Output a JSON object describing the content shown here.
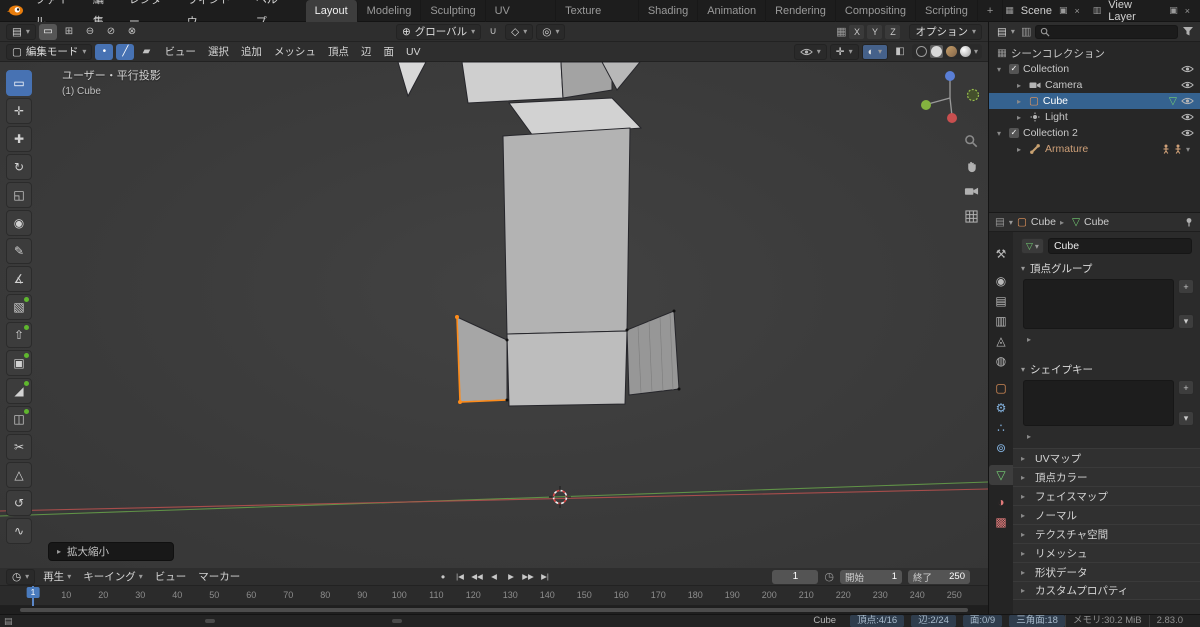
{
  "icons": {
    "chevron-down": "▾",
    "chevron-right": "▸",
    "editor-grid": "▤",
    "clock": "◷",
    "mode-new": "▭",
    "mode-extend": "⊞",
    "mode-subtract": "⊖",
    "mode-invert": "⊘",
    "mode-intersect": "⊗",
    "orientation-globe": "⊕",
    "magnet": "∪",
    "snap-target": "◇",
    "proportional": "◎",
    "falloff-grid": "▦",
    "mode-cube": "▢",
    "vertex-mode": "•",
    "edge-mode": "╱",
    "face-mode": "▰",
    "gizmo": "✛",
    "overlays": "◐",
    "xray": "◧",
    "scene": "▦",
    "view-layer": "▥",
    "copy": "▣",
    "close": "×",
    "collection": "▦",
    "mesh-data": "▽",
    "cube-object": "▢",
    "check": "✓",
    "plus": "+",
    "minus": "−"
  },
  "topbar": {
    "menus": [
      {
        "name": "menu-file",
        "label": "ファイル"
      },
      {
        "name": "menu-edit",
        "label": "編集"
      },
      {
        "name": "menu-render",
        "label": "レンダー"
      },
      {
        "name": "menu-window",
        "label": "ウィンドウ"
      },
      {
        "name": "menu-help",
        "label": "ヘルプ"
      }
    ],
    "workspaces": [
      {
        "name": "workspace-tab-layout",
        "label": "Layout",
        "active": true
      },
      {
        "name": "workspace-tab-modeling",
        "label": "Modeling"
      },
      {
        "name": "workspace-tab-sculpting",
        "label": "Sculpting"
      },
      {
        "name": "workspace-tab-uv-editing",
        "label": "UV Editing"
      },
      {
        "name": "workspace-tab-texture-paint",
        "label": "Texture Paint"
      },
      {
        "name": "workspace-tab-shading",
        "label": "Shading"
      },
      {
        "name": "workspace-tab-animation",
        "label": "Animation"
      },
      {
        "name": "workspace-tab-rendering",
        "label": "Rendering"
      },
      {
        "name": "workspace-tab-compositing",
        "label": "Compositing"
      },
      {
        "name": "workspace-tab-scripting",
        "label": "Scripting"
      },
      {
        "name": "add-workspace-button",
        "label": "+"
      }
    ],
    "scene_label": "Scene",
    "view_layer_label": "View Layer"
  },
  "tool_settings": {
    "orientation_label": "グローバル",
    "axis_x": "X",
    "axis_y": "Y",
    "axis_z": "Z",
    "options_label": "オプション"
  },
  "header3d": {
    "mode_label": "編集モード",
    "menus": [
      {
        "name": "menu-view",
        "label": "ビュー"
      },
      {
        "name": "menu-select",
        "label": "選択"
      },
      {
        "name": "menu-add",
        "label": "追加"
      },
      {
        "name": "menu-mesh",
        "label": "メッシュ"
      },
      {
        "name": "menu-vertex",
        "label": "頂点"
      },
      {
        "name": "menu-edge",
        "label": "辺"
      },
      {
        "name": "menu-face",
        "label": "面"
      },
      {
        "name": "menu-uv",
        "label": "UV"
      }
    ]
  },
  "toolbar": {
    "tools": [
      {
        "name": "tool-select-box",
        "glyph": "▭",
        "active": true
      },
      {
        "name": "tool-cursor",
        "glyph": "✛"
      },
      {
        "name": "tool-move",
        "glyph": "✚"
      },
      {
        "name": "tool-rotate",
        "glyph": "↻"
      },
      {
        "name": "tool-scale",
        "glyph": "◱"
      },
      {
        "name": "tool-transform",
        "glyph": "◉"
      },
      {
        "name": "tool-annotate",
        "glyph": "✎"
      },
      {
        "name": "tool-measure",
        "glyph": "∡"
      },
      {
        "name": "tool-add-cube",
        "glyph": "▧",
        "badge": true
      },
      {
        "name": "tool-extrude",
        "glyph": "⇧",
        "badge": true
      },
      {
        "name": "tool-inset",
        "glyph": "▣",
        "badge": true
      },
      {
        "name": "tool-bevel",
        "glyph": "◢",
        "badge": true
      },
      {
        "name": "tool-loop-cut",
        "glyph": "◫",
        "badge": true
      },
      {
        "name": "tool-knife",
        "glyph": "✂"
      },
      {
        "name": "tool-poly-build",
        "glyph": "△"
      },
      {
        "name": "tool-spin",
        "glyph": "↺"
      },
      {
        "name": "tool-smooth",
        "glyph": "∿"
      }
    ]
  },
  "viewport": {
    "view_label": "ユーザー・平行投影",
    "object_label": "(1) Cube",
    "operator_panel_label": "拡大縮小",
    "axis_x_color": "#b4504e",
    "axis_y_color": "#67a24a",
    "selection_color": "#ff8c1a"
  },
  "timeline": {
    "editor_menus": [
      {
        "name": "menu-playback",
        "label": "再生",
        "caret": true
      },
      {
        "name": "menu-keying",
        "label": "キーイング",
        "caret": true
      },
      {
        "name": "menu-timeline-view",
        "label": "ビュー"
      },
      {
        "name": "menu-marker",
        "label": "マーカー"
      }
    ],
    "transport": [
      {
        "name": "record-button",
        "glyph": "●"
      },
      {
        "name": "jump-to-start-button",
        "glyph": "|◀"
      },
      {
        "name": "previous-keyframe-button",
        "glyph": "◀◀"
      },
      {
        "name": "play-reverse-button",
        "glyph": "◀"
      },
      {
        "name": "play-button",
        "glyph": "▶"
      },
      {
        "name": "next-keyframe-button",
        "glyph": "▶▶"
      },
      {
        "name": "jump-to-end-button",
        "glyph": "▶|"
      }
    ],
    "current_frame": "1",
    "first_frame_label": "1",
    "start_label": "開始",
    "start_value": "1",
    "end_label": "終了",
    "end_value": "250",
    "ticks": [
      10,
      20,
      30,
      40,
      50,
      60,
      70,
      80,
      90,
      100,
      110,
      120,
      130,
      140,
      150,
      160,
      170,
      180,
      190,
      200,
      210,
      220,
      230,
      240,
      250
    ]
  },
  "outliner": {
    "rows": [
      {
        "label": "シーンコレクション"
      },
      {
        "label": "Collection"
      },
      {
        "label": "Camera"
      },
      {
        "label": "Cube",
        "selected": true
      },
      {
        "label": "Light"
      },
      {
        "label": "Collection 2"
      },
      {
        "label": "Armature"
      }
    ]
  },
  "properties": {
    "tabs": [
      {
        "name": "tab-tool",
        "glyph": "⚒",
        "color": "#b8b8b8"
      },
      {
        "name": "tab-render",
        "glyph": "◉",
        "color": "#b8b8b8",
        "gap": true
      },
      {
        "name": "tab-output",
        "glyph": "▤",
        "color": "#b8b8b8"
      },
      {
        "name": "tab-view-layer",
        "glyph": "▥",
        "color": "#b8b8b8"
      },
      {
        "name": "tab-scene",
        "glyph": "◬",
        "color": "#b8b8b8"
      },
      {
        "name": "tab-world",
        "glyph": "◍",
        "color": "#b8b8b8"
      },
      {
        "name": "tab-object",
        "glyph": "▢",
        "color": "#e8975c",
        "gap": true
      },
      {
        "name": "tab-modifiers",
        "glyph": "⚙",
        "color": "#84b3e0"
      },
      {
        "name": "tab-particles",
        "glyph": "∴",
        "color": "#84b3e0"
      },
      {
        "name": "tab-physics",
        "glyph": "⊚",
        "color": "#84b3e0"
      },
      {
        "name": "tab-object-data",
        "glyph": "▽",
        "color": "#74ce74",
        "active": true,
        "gap": true
      },
      {
        "name": "tab-material",
        "glyph": "◑",
        "color": "#e07a7a",
        "gap": true
      },
      {
        "name": "tab-texture",
        "glyph": "▩",
        "color": "#e07a7a"
      }
    ],
    "breadcrumb_object": "Cube",
    "breadcrumb_data": "Cube",
    "name_value": "Cube",
    "panel_vertex_groups": "頂点グループ",
    "panel_shape_keys": "シェイプキー",
    "collapsed_panels": [
      {
        "name": "panel-uv-maps",
        "label": "UVマップ"
      },
      {
        "name": "panel-vertex-colors",
        "label": "頂点カラー"
      },
      {
        "name": "panel-face-maps",
        "label": "フェイスマップ"
      },
      {
        "name": "panel-normals",
        "label": "ノーマル"
      },
      {
        "name": "panel-texture-space",
        "label": "テクスチャ空間"
      },
      {
        "name": "panel-remesh",
        "label": "リメッシュ"
      },
      {
        "name": "panel-geometry-data",
        "label": "形状データ"
      },
      {
        "name": "panel-custom-properties",
        "label": "カスタムプロパティ"
      }
    ]
  },
  "statusbar": {
    "object_name": "Cube",
    "stats": [
      {
        "name": "stat-vertices",
        "label": "頂点:4/16",
        "chip": true
      },
      {
        "name": "stat-edges",
        "label": "辺:2/24",
        "chip": true
      },
      {
        "name": "stat-faces",
        "label": "面:0/9",
        "chip": true
      },
      {
        "name": "stat-triangles",
        "label": "三角面:18",
        "chip": true
      },
      {
        "name": "stat-memory",
        "label": "メモリ:30.2 MiB",
        "chip": false
      }
    ],
    "version": "2.83.0"
  }
}
